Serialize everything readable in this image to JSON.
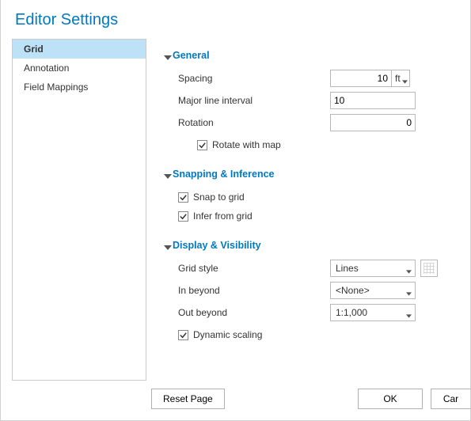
{
  "title": "Editor Settings",
  "sidebar": {
    "items": [
      {
        "label": "Grid",
        "selected": true
      },
      {
        "label": "Annotation",
        "selected": false
      },
      {
        "label": "Field Mappings",
        "selected": false
      }
    ]
  },
  "sections": {
    "general": {
      "title": "General",
      "spacing_label": "Spacing",
      "spacing_value": "10",
      "spacing_unit": "ft",
      "major_label": "Major line interval",
      "major_value": "10",
      "rotation_label": "Rotation",
      "rotation_value": "0",
      "rotate_with_map_label": "Rotate with map",
      "rotate_with_map_checked": true
    },
    "snapping": {
      "title": "Snapping & Inference",
      "snap_label": "Snap to grid",
      "snap_checked": true,
      "infer_label": "Infer from grid",
      "infer_checked": true
    },
    "display": {
      "title": "Display & Visibility",
      "style_label": "Grid style",
      "style_value": "Lines",
      "in_beyond_label": "In beyond",
      "in_beyond_value": "<None>",
      "out_beyond_label": "Out beyond",
      "out_beyond_value": "1:1,000",
      "dynamic_label": "Dynamic scaling",
      "dynamic_checked": true
    }
  },
  "footer": {
    "reset_label": "Reset Page",
    "ok_label": "OK",
    "cancel_label": "Cancel"
  }
}
